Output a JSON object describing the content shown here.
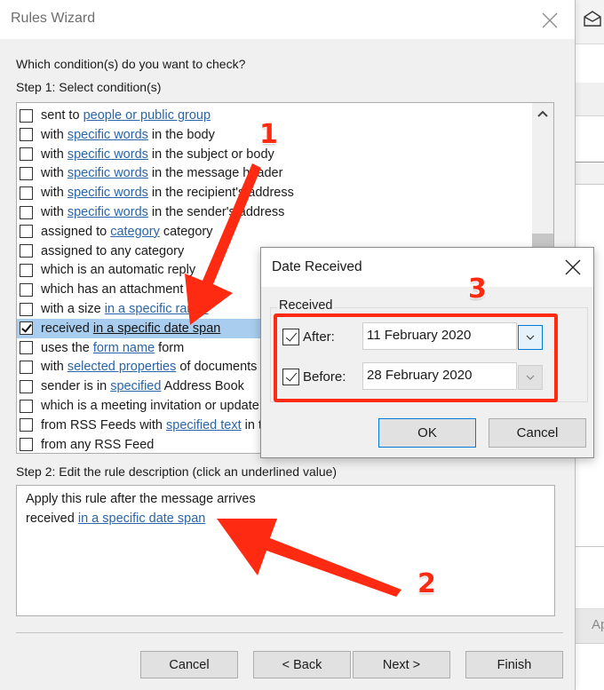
{
  "background_app": {
    "partial_button_label": "Ap"
  },
  "wizard": {
    "title": "Rules Wizard",
    "question": "Which condition(s) do you want to check?",
    "step1_label": "Step 1: Select condition(s)",
    "conditions": [
      {
        "pre": "sent to ",
        "link": "people or public group",
        "post": "",
        "checked": false
      },
      {
        "pre": "with ",
        "link": "specific words",
        "post": " in the body",
        "checked": false
      },
      {
        "pre": "with ",
        "link": "specific words",
        "post": " in the subject or body",
        "checked": false
      },
      {
        "pre": "with ",
        "link": "specific words",
        "post": " in the message header",
        "checked": false
      },
      {
        "pre": "with ",
        "link": "specific words",
        "post": " in the recipient's address",
        "checked": false
      },
      {
        "pre": "with ",
        "link": "specific words",
        "post": " in the sender's address",
        "checked": false
      },
      {
        "pre": "assigned to ",
        "link": "category",
        "post": " category",
        "checked": false
      },
      {
        "pre": "assigned to any category",
        "link": "",
        "post": "",
        "checked": false
      },
      {
        "pre": "which is an automatic reply",
        "link": "",
        "post": "",
        "checked": false
      },
      {
        "pre": "which has an attachment",
        "link": "",
        "post": "",
        "checked": false
      },
      {
        "pre": "with a size ",
        "link": "in a specific range",
        "post": "",
        "checked": false
      },
      {
        "pre": "received ",
        "link": "in a specific date span",
        "post": "",
        "checked": true
      },
      {
        "pre": "uses the ",
        "link": "form name",
        "post": " form",
        "checked": false
      },
      {
        "pre": "with ",
        "link": "selected properties",
        "post": " of documents or forms",
        "checked": false
      },
      {
        "pre": "sender is in ",
        "link": "specified",
        "post": " Address Book",
        "checked": false
      },
      {
        "pre": "which is a meeting invitation or update",
        "link": "",
        "post": "",
        "checked": false
      },
      {
        "pre": "from RSS Feeds with ",
        "link": "specified text",
        "post": " in the title",
        "checked": false
      },
      {
        "pre": "from any RSS Feed",
        "link": "",
        "post": "",
        "checked": false
      }
    ],
    "selected_condition_index": 11,
    "step2_label": "Step 2: Edit the rule description (click an underlined value)",
    "description": {
      "line1": "Apply this rule after the message arrives",
      "line2_pre": "received ",
      "line2_link": "in a specific date span"
    },
    "buttons": {
      "cancel": "Cancel",
      "back": "< Back",
      "next": "Next >",
      "finish": "Finish"
    }
  },
  "date_dialog": {
    "title": "Date Received",
    "group_label": "Received",
    "after": {
      "label": "After:",
      "checked": true,
      "value": "11 February 2020"
    },
    "before": {
      "label": "Before:",
      "checked": true,
      "value": "28 February 2020"
    },
    "ok": "OK",
    "cancel": "Cancel"
  },
  "annotations": {
    "step_numbers": [
      "1",
      "2",
      "3"
    ],
    "color": "#ff2a12"
  },
  "colors": {
    "link": "#2a65a8",
    "selection": "#a9cdee",
    "focus_border": "#0078d7"
  }
}
